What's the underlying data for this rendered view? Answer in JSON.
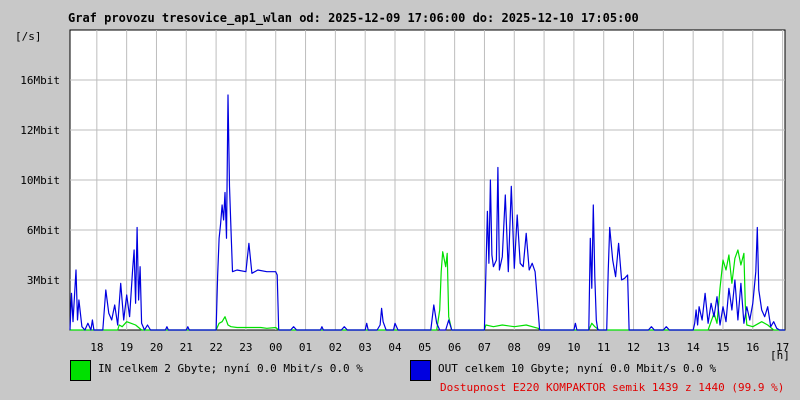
{
  "chart_data": {
    "type": "line",
    "title": "Graf provozu tresovice_ap1_wlan od: 2025-12-09 17:06:00 do: 2025-12-10 17:05:00",
    "ylabel": "[/s]",
    "xlabel": "[h]",
    "x_ticks": [
      "18",
      "19",
      "20",
      "21",
      "22",
      "23",
      "00",
      "01",
      "02",
      "03",
      "04",
      "05",
      "06",
      "07",
      "08",
      "09",
      "10",
      "11",
      "12",
      "13",
      "14",
      "15",
      "16",
      "17"
    ],
    "x_range_hours": [
      17.1,
      41.08
    ],
    "y_ticks": [
      {
        "label": "3Mbit",
        "value": 3
      },
      {
        "label": "6Mbit",
        "value": 6
      },
      {
        "label": "10Mbit",
        "value": 10
      },
      {
        "label": "12Mbit",
        "value": 12
      },
      {
        "label": "16Mbit",
        "value": 16
      }
    ],
    "y_units": "Mbit/s",
    "grid": true,
    "series": [
      {
        "name": "IN",
        "color": "#00e000",
        "points": [
          [
            17.1,
            0
          ],
          [
            18.7,
            0
          ],
          [
            18.75,
            0.3
          ],
          [
            18.85,
            0.2
          ],
          [
            19.0,
            0.5
          ],
          [
            19.15,
            0.4
          ],
          [
            19.3,
            0.3
          ],
          [
            19.5,
            0
          ],
          [
            22.0,
            0
          ],
          [
            22.1,
            0.4
          ],
          [
            22.2,
            0.5
          ],
          [
            22.3,
            0.8
          ],
          [
            22.4,
            0.3
          ],
          [
            22.5,
            0.2
          ],
          [
            22.7,
            0.15
          ],
          [
            23.0,
            0.15
          ],
          [
            23.5,
            0.15
          ],
          [
            23.7,
            0.1
          ],
          [
            24.0,
            0.15
          ],
          [
            24.1,
            0
          ],
          [
            29.4,
            0
          ],
          [
            29.5,
            1.2
          ],
          [
            29.55,
            3.5
          ],
          [
            29.6,
            4.7
          ],
          [
            29.7,
            3.8
          ],
          [
            29.75,
            4.6
          ],
          [
            29.8,
            0.8
          ],
          [
            29.9,
            0
          ],
          [
            31.0,
            0
          ],
          [
            31.05,
            0.3
          ],
          [
            31.3,
            0.2
          ],
          [
            31.6,
            0.3
          ],
          [
            32.0,
            0.2
          ],
          [
            32.4,
            0.3
          ],
          [
            32.8,
            0.1
          ],
          [
            32.9,
            0
          ],
          [
            34.5,
            0
          ],
          [
            34.6,
            0.4
          ],
          [
            34.7,
            0.2
          ],
          [
            34.85,
            0
          ],
          [
            38.5,
            0
          ],
          [
            38.7,
            1.0
          ],
          [
            38.8,
            0.4
          ],
          [
            38.9,
            2.5
          ],
          [
            39.0,
            4.2
          ],
          [
            39.1,
            3.6
          ],
          [
            39.2,
            4.5
          ],
          [
            39.3,
            2.8
          ],
          [
            39.4,
            4.3
          ],
          [
            39.5,
            4.8
          ],
          [
            39.6,
            3.9
          ],
          [
            39.7,
            4.6
          ],
          [
            39.75,
            1.5
          ],
          [
            39.8,
            0.3
          ],
          [
            40.0,
            0.2
          ],
          [
            40.3,
            0.5
          ],
          [
            40.5,
            0.3
          ],
          [
            40.7,
            0
          ],
          [
            41.08,
            0
          ]
        ]
      },
      {
        "name": "OUT",
        "color": "#0000e0",
        "points": [
          [
            17.1,
            0
          ],
          [
            17.15,
            2.2
          ],
          [
            17.2,
            0.5
          ],
          [
            17.3,
            3.6
          ],
          [
            17.35,
            0.6
          ],
          [
            17.4,
            1.8
          ],
          [
            17.5,
            0.2
          ],
          [
            17.6,
            0
          ],
          [
            17.7,
            0.4
          ],
          [
            17.8,
            0
          ],
          [
            17.85,
            0.6
          ],
          [
            17.9,
            0
          ],
          [
            18.2,
            0
          ],
          [
            18.3,
            2.4
          ],
          [
            18.4,
            1.0
          ],
          [
            18.5,
            0.6
          ],
          [
            18.6,
            1.5
          ],
          [
            18.7,
            0.3
          ],
          [
            18.8,
            2.8
          ],
          [
            18.9,
            0.6
          ],
          [
            19.0,
            2.1
          ],
          [
            19.1,
            0.8
          ],
          [
            19.2,
            3.6
          ],
          [
            19.25,
            4.8
          ],
          [
            19.3,
            1.6
          ],
          [
            19.35,
            6.2
          ],
          [
            19.4,
            1.8
          ],
          [
            19.45,
            3.8
          ],
          [
            19.5,
            0.4
          ],
          [
            19.6,
            0
          ],
          [
            19.7,
            0.3
          ],
          [
            19.8,
            0
          ],
          [
            20.3,
            0
          ],
          [
            20.35,
            0.2
          ],
          [
            20.4,
            0
          ],
          [
            21.0,
            0
          ],
          [
            21.05,
            0.2
          ],
          [
            21.1,
            0
          ],
          [
            22.0,
            0
          ],
          [
            22.05,
            3.2
          ],
          [
            22.1,
            5.5
          ],
          [
            22.15,
            6.5
          ],
          [
            22.2,
            8.0
          ],
          [
            22.25,
            6.8
          ],
          [
            22.3,
            9.0
          ],
          [
            22.35,
            5.5
          ],
          [
            22.4,
            14.8
          ],
          [
            22.45,
            9.5
          ],
          [
            22.5,
            6.0
          ],
          [
            22.55,
            3.5
          ],
          [
            22.7,
            3.6
          ],
          [
            23.0,
            3.5
          ],
          [
            23.1,
            5.2
          ],
          [
            23.2,
            3.4
          ],
          [
            23.4,
            3.6
          ],
          [
            23.7,
            3.5
          ],
          [
            24.0,
            3.5
          ],
          [
            24.05,
            3.3
          ],
          [
            24.1,
            0
          ],
          [
            24.5,
            0
          ],
          [
            24.6,
            0.2
          ],
          [
            24.7,
            0
          ],
          [
            25.5,
            0
          ],
          [
            25.55,
            0.2
          ],
          [
            25.6,
            0
          ],
          [
            26.2,
            0
          ],
          [
            26.3,
            0.2
          ],
          [
            26.4,
            0
          ],
          [
            27.0,
            0
          ],
          [
            27.05,
            0.4
          ],
          [
            27.1,
            0
          ],
          [
            27.4,
            0
          ],
          [
            27.5,
            0.3
          ],
          [
            27.55,
            1.3
          ],
          [
            27.6,
            0.5
          ],
          [
            27.7,
            0
          ],
          [
            27.95,
            0
          ],
          [
            28.0,
            0.4
          ],
          [
            28.1,
            0
          ],
          [
            29.2,
            0
          ],
          [
            29.3,
            1.5
          ],
          [
            29.4,
            0.4
          ],
          [
            29.5,
            0
          ],
          [
            29.7,
            0
          ],
          [
            29.8,
            0.6
          ],
          [
            29.9,
            0
          ],
          [
            31.0,
            0
          ],
          [
            31.05,
            3.5
          ],
          [
            31.1,
            7.5
          ],
          [
            31.15,
            4.0
          ],
          [
            31.2,
            10.0
          ],
          [
            31.25,
            4.5
          ],
          [
            31.3,
            3.8
          ],
          [
            31.4,
            4.2
          ],
          [
            31.45,
            10.5
          ],
          [
            31.5,
            3.6
          ],
          [
            31.6,
            4.4
          ],
          [
            31.7,
            8.8
          ],
          [
            31.8,
            3.5
          ],
          [
            31.9,
            9.5
          ],
          [
            32.0,
            3.7
          ],
          [
            32.1,
            7.2
          ],
          [
            32.2,
            4.0
          ],
          [
            32.3,
            3.8
          ],
          [
            32.4,
            5.8
          ],
          [
            32.5,
            3.6
          ],
          [
            32.6,
            4.0
          ],
          [
            32.7,
            3.5
          ],
          [
            32.8,
            1.2
          ],
          [
            32.85,
            0
          ],
          [
            34.0,
            0
          ],
          [
            34.05,
            0.4
          ],
          [
            34.1,
            0
          ],
          [
            34.5,
            0
          ],
          [
            34.55,
            5.5
          ],
          [
            34.6,
            2.5
          ],
          [
            34.65,
            8.0
          ],
          [
            34.7,
            3.2
          ],
          [
            34.75,
            0.6
          ],
          [
            34.8,
            0
          ],
          [
            35.1,
            0
          ],
          [
            35.15,
            3.5
          ],
          [
            35.2,
            6.2
          ],
          [
            35.3,
            4.2
          ],
          [
            35.4,
            3.2
          ],
          [
            35.5,
            5.2
          ],
          [
            35.6,
            3.0
          ],
          [
            35.7,
            3.1
          ],
          [
            35.8,
            3.3
          ],
          [
            35.85,
            0
          ],
          [
            36.5,
            0
          ],
          [
            36.6,
            0.2
          ],
          [
            36.7,
            0
          ],
          [
            37.0,
            0
          ],
          [
            37.1,
            0.2
          ],
          [
            37.2,
            0
          ],
          [
            38.0,
            0
          ],
          [
            38.05,
            0.4
          ],
          [
            38.1,
            1.2
          ],
          [
            38.15,
            0.3
          ],
          [
            38.2,
            1.4
          ],
          [
            38.3,
            0.6
          ],
          [
            38.4,
            2.2
          ],
          [
            38.5,
            0.4
          ],
          [
            38.6,
            1.6
          ],
          [
            38.7,
            0.8
          ],
          [
            38.8,
            2.0
          ],
          [
            38.9,
            0.3
          ],
          [
            39.0,
            1.4
          ],
          [
            39.1,
            0.5
          ],
          [
            39.2,
            2.5
          ],
          [
            39.3,
            1.2
          ],
          [
            39.4,
            3.0
          ],
          [
            39.5,
            0.6
          ],
          [
            39.6,
            2.8
          ],
          [
            39.7,
            0.4
          ],
          [
            39.8,
            1.4
          ],
          [
            39.9,
            0.6
          ],
          [
            40.0,
            1.6
          ],
          [
            40.1,
            3.5
          ],
          [
            40.15,
            6.2
          ],
          [
            40.2,
            2.4
          ],
          [
            40.3,
            1.2
          ],
          [
            40.4,
            0.8
          ],
          [
            40.5,
            1.4
          ],
          [
            40.6,
            0.2
          ],
          [
            40.7,
            0.5
          ],
          [
            40.8,
            0.1
          ],
          [
            40.9,
            0
          ],
          [
            41.08,
            0
          ]
        ]
      }
    ],
    "legend": [
      {
        "label": "IN celkem 2 Gbyte; nyní   0.0 Mbit/s 0.0 %",
        "color": "#00e000"
      },
      {
        "label": "OUT celkem 10 Gbyte; nyní   0.0 Mbit/s 0.0 %",
        "color": "#0000e0"
      }
    ],
    "availability": "Dostupnost E220 KOMPAKTOR semik 1439 z 1440 (99.9 %)"
  }
}
